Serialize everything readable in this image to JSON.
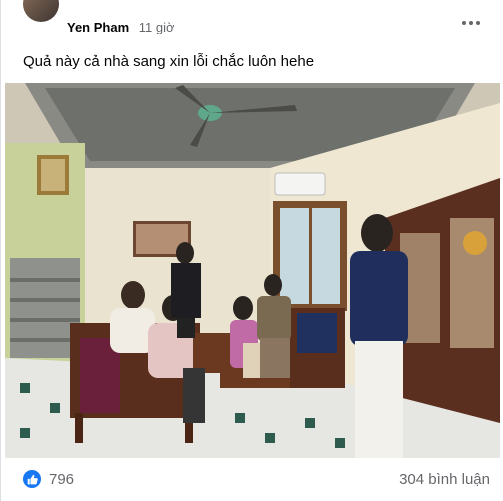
{
  "post": {
    "author_name": "Yen Pham",
    "timestamp": "11 giờ",
    "caption": "Quả này cả nhà sang xin lỗi chắc luôn hehe",
    "more_icon": "ellipsis-horizontal-icon",
    "photo_alt": "Gia đình ngồi trên ghế gỗ trong phòng khách có quạt trần và điều hòa"
  },
  "reactions": {
    "icon": "like-thumbs-up-icon",
    "count": "796"
  },
  "comments": {
    "count_label": "304 bình luận"
  },
  "colors": {
    "accent": "#1877f2",
    "secondary_text": "#65676b"
  }
}
